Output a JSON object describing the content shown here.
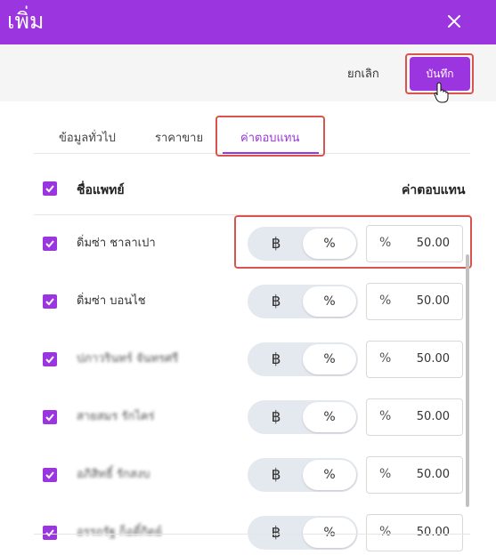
{
  "dialog": {
    "title": "เพิ่ม",
    "close_icon": "close-icon",
    "accent_color": "#9b35e0",
    "highlight_color": "#d9534f"
  },
  "actions": {
    "cancel_label": "ยกเลิก",
    "save_label": "บันทึก"
  },
  "tabs": [
    {
      "label": "ข้อมูลทั่วไป",
      "active": false
    },
    {
      "label": "ราคาขาย",
      "active": false
    },
    {
      "label": "ค่าตอบแทน",
      "active": true
    }
  ],
  "table": {
    "col_name": "ชื่อแพทย์",
    "col_rate": "ค่าตอบแทน",
    "rows": [
      {
        "name": "ดิ่มซ่า ชาลาเปา",
        "unit_baht": "฿",
        "unit_pct": "%",
        "rate_icon": "%",
        "rate": "50.00",
        "checked": true
      },
      {
        "name": "ดิ่มซ่า บอนไช",
        "unit_baht": "฿",
        "unit_pct": "%",
        "rate_icon": "%",
        "rate": "50.00",
        "checked": true
      },
      {
        "name": "ปภาวรินทร์ จันทรศรี",
        "unit_baht": "฿",
        "unit_pct": "%",
        "rate_icon": "%",
        "rate": "50.00",
        "checked": true
      },
      {
        "name": "สายสมร รักไคร่",
        "unit_baht": "฿",
        "unit_pct": "%",
        "rate_icon": "%",
        "rate": "50.00",
        "checked": true
      },
      {
        "name": "อภิสิทธิ์ รักสงบ",
        "unit_baht": "฿",
        "unit_pct": "%",
        "rate_icon": "%",
        "rate": "50.00",
        "checked": true
      },
      {
        "name": "อรรถรัฐ ก็อดิ์กิตย์",
        "unit_baht": "฿",
        "unit_pct": "%",
        "rate_icon": "%",
        "rate": "50.00",
        "checked": true
      }
    ]
  }
}
